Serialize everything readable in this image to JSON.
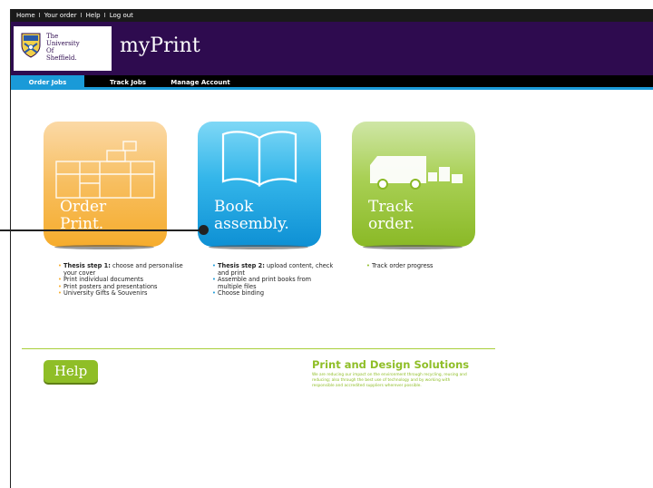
{
  "topbar": {
    "links": [
      "Home",
      "Your order",
      "Help",
      "Log out"
    ],
    "separator": "I"
  },
  "header": {
    "university_lines": [
      "The",
      "University",
      "Of",
      "Sheffield."
    ],
    "app_title": "myPrint",
    "colors": {
      "header_bg": "#2e0b4f",
      "accent": "#1a9ad8",
      "green": "#8fbe27"
    }
  },
  "nav": {
    "tabs": [
      {
        "label": "Order Jobs",
        "active": true
      },
      {
        "label": "Track Jobs",
        "active": false
      },
      {
        "label": "Manage Account",
        "active": false
      }
    ]
  },
  "tiles": [
    {
      "label_line1": "Order",
      "label_line2": "Print.",
      "icon": "printer-icon",
      "color": "#f7b531",
      "bullets": [
        {
          "bold": "Thesis step 1:",
          "text": " choose and personalise your cover"
        },
        {
          "bold": "",
          "text": "Print individual documents"
        },
        {
          "bold": "",
          "text": "Print posters and presentations"
        },
        {
          "bold": "",
          "text": "University Gifts & Souvenirs"
        }
      ]
    },
    {
      "label_line1": "Book",
      "label_line2": "assembly.",
      "icon": "open-book-icon",
      "color": "#1a9ad8",
      "bullets": [
        {
          "bold": "Thesis step 2:",
          "text": " upload content, check and print"
        },
        {
          "bold": "",
          "text": "Assemble and print books from multiple files"
        },
        {
          "bold": "",
          "text": "Choose binding"
        }
      ]
    },
    {
      "label_line1": "Track",
      "label_line2": "order.",
      "icon": "delivery-van-icon",
      "color": "#8fbe27",
      "bullets": [
        {
          "bold": "",
          "text": "Track order progress"
        }
      ]
    }
  ],
  "footer": {
    "help_label": "Help",
    "pds_title": "Print and Design Solutions",
    "pds_text": "We are reducing our impact on the environment through recycling, reusing and reducing; also through the best use of technology and by working with responsible and accredited suppliers wherever possible."
  }
}
